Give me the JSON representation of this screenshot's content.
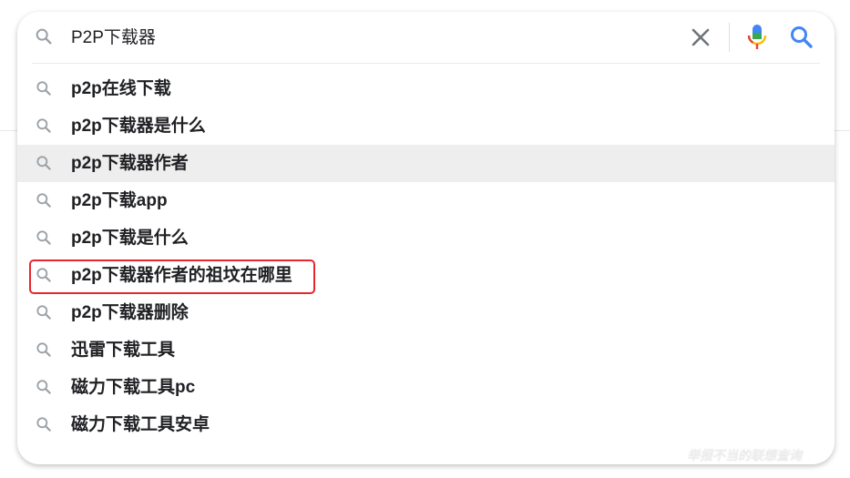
{
  "search": {
    "query": "P2P下载器",
    "icons": {
      "lead": "search-icon",
      "clear": "close-icon",
      "mic": "mic-icon",
      "submit": "search-icon"
    }
  },
  "suggestions": [
    {
      "text": "p2p在线下载",
      "selected": false
    },
    {
      "text": "p2p下载器是什么",
      "selected": false
    },
    {
      "text": "p2p下载器作者",
      "selected": true
    },
    {
      "text": "p2p下载app",
      "selected": false
    },
    {
      "text": "p2p下载是什么",
      "selected": false
    },
    {
      "text": "p2p下载器作者的祖坟在哪里",
      "selected": false
    },
    {
      "text": "p2p下载器删除",
      "selected": false
    },
    {
      "text": "迅雷下载工具",
      "selected": false
    },
    {
      "text": "磁力下载工具pc",
      "selected": false
    },
    {
      "text": "磁力下载工具安卓",
      "selected": false
    }
  ],
  "annotation": {
    "highlight_color": "#e8262d",
    "highlighted_suggestion": "p2p下载器作者的祖坟在哪里"
  },
  "footer": {
    "report_link": "举报不当的联想查询"
  },
  "colors": {
    "icon_gray": "#9aa0a6",
    "text": "#202124",
    "selected_bg": "#eeeeee",
    "google_blue": "#4285f4",
    "google_red": "#ea4335",
    "google_yellow": "#fbbc04",
    "google_green": "#34a853"
  }
}
